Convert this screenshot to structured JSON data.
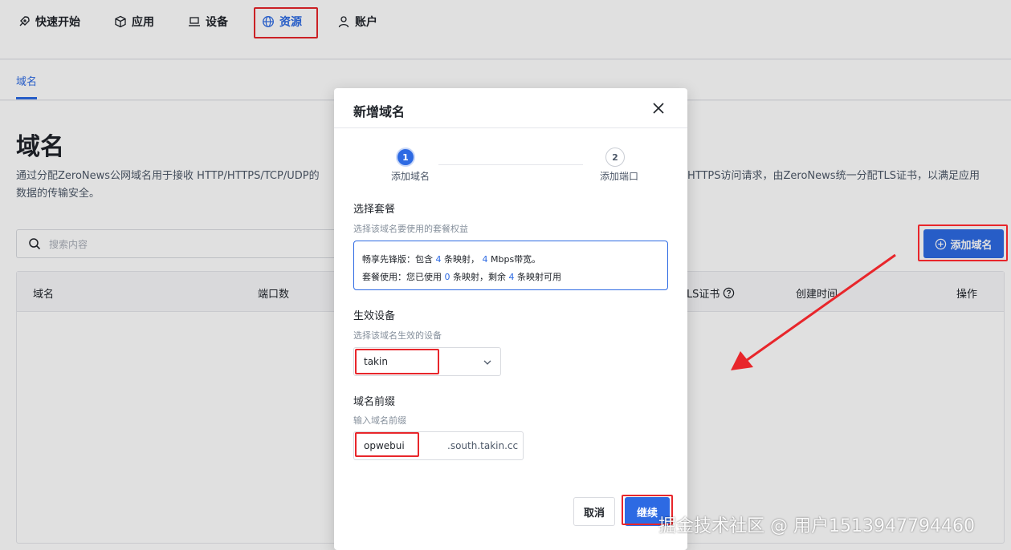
{
  "nav": {
    "items": [
      {
        "label": "快速开始",
        "icon": "rocket-icon"
      },
      {
        "label": "应用",
        "icon": "cube-icon"
      },
      {
        "label": "设备",
        "icon": "laptop-icon"
      },
      {
        "label": "资源",
        "icon": "globe-icon",
        "active": true
      },
      {
        "label": "账户",
        "icon": "user-icon"
      }
    ]
  },
  "subtabs": {
    "active": "域名"
  },
  "page": {
    "title": "域名",
    "desc_line1_left": "通过分配ZeroNews公网域名用于接收 HTTP/HTTPS/TCP/UDP的",
    "desc_line1_right": "HTTPS访问请求，由ZeroNews统一分配TLS证书，以满足应用",
    "desc_line2": "数据的传输安全。",
    "search_placeholder": "搜索内容",
    "add_button": "添加域名"
  },
  "table": {
    "columns": [
      "域名",
      "端口数",
      "TLS证书",
      "创建时间",
      "操作"
    ]
  },
  "dialog": {
    "title": "新增域名",
    "steps": [
      {
        "num": "1",
        "label": "添加域名"
      },
      {
        "num": "2",
        "label": "添加端口"
      }
    ],
    "plan": {
      "title": "选择套餐",
      "subtitle": "选择该域名要使用的套餐权益",
      "line1_a": "畅享先锋版：包含",
      "line1_n1": "4",
      "line1_b": "条映射，",
      "line1_n2": "4",
      "line1_c": "Mbps带宽。",
      "line2_a": "套餐使用：您已使用",
      "line2_n1": "0",
      "line2_b": "条映射，剩余",
      "line2_n2": "4",
      "line2_c": "条映射可用"
    },
    "device": {
      "title": "生效设备",
      "subtitle": "选择该域名生效的设备",
      "value": "takin"
    },
    "prefix": {
      "title": "域名前缀",
      "subtitle": "输入域名前缀",
      "value": "opwebui",
      "suffix": ".south.takin.cc"
    },
    "cancel": "取消",
    "continue": "继续"
  },
  "watermark": "掘金技术社区 @ 用户1513947794460",
  "colors": {
    "accent": "#2d6ae3",
    "annotation": "#e8262b"
  }
}
